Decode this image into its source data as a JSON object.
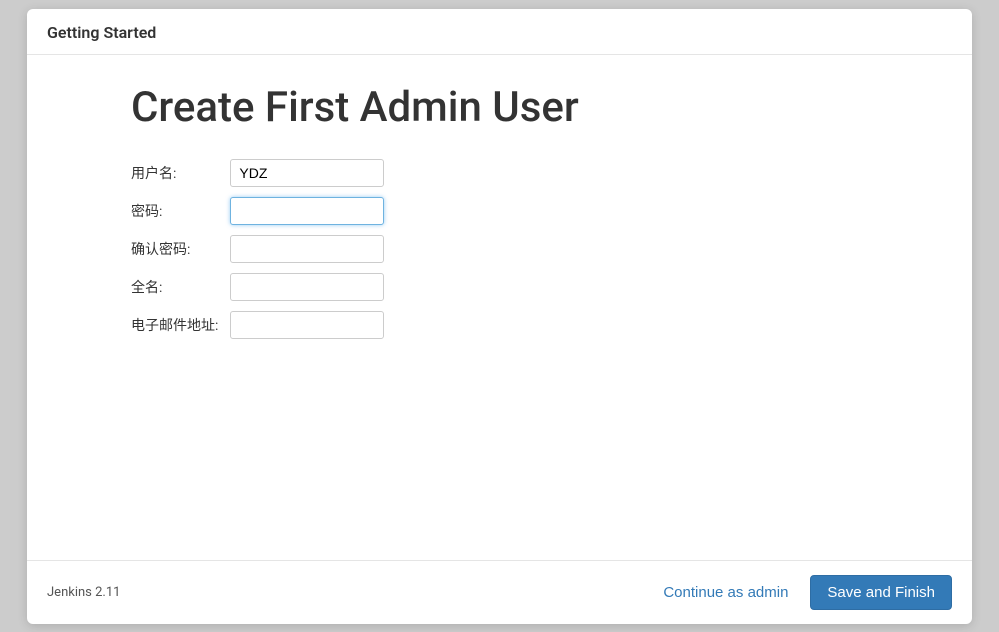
{
  "header": {
    "title": "Getting Started"
  },
  "main": {
    "heading": "Create First Admin User",
    "form": {
      "username": {
        "label": "用户名:",
        "value": "YDZ"
      },
      "password": {
        "label": "密码:",
        "value": ""
      },
      "confirm_password": {
        "label": "确认密码:",
        "value": ""
      },
      "fullname": {
        "label": "全名:",
        "value": ""
      },
      "email": {
        "label": "电子邮件地址:",
        "value": ""
      }
    }
  },
  "footer": {
    "version": "Jenkins 2.11",
    "continue_label": "Continue as admin",
    "save_label": "Save and Finish"
  }
}
